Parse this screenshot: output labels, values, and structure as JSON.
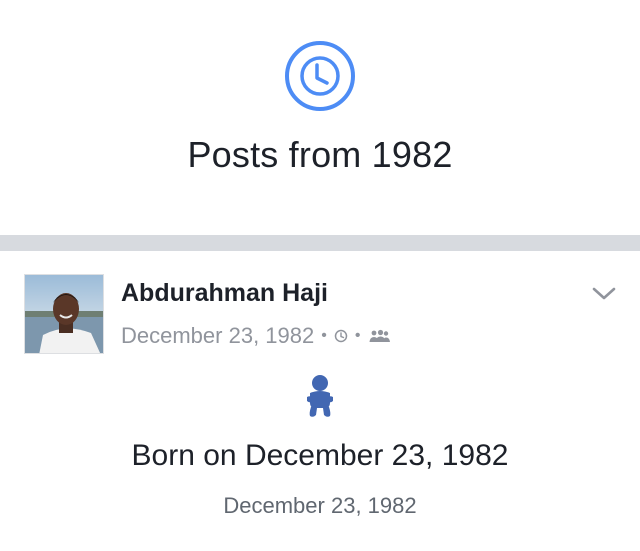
{
  "header": {
    "icon": "clock-icon",
    "title": "Posts from 1982",
    "accent_color": "#4d8cf5"
  },
  "post": {
    "author_name": "Abdurahman Haji",
    "timestamp": "December 23, 1982",
    "meta_icons": [
      "clock-icon",
      "friends-audience-icon"
    ],
    "menu_icon": "chevron-down-icon",
    "event_icon": "baby-icon",
    "event_icon_color": "#4267b2",
    "event_title": "Born on December 23, 1982",
    "event_date": "December 23, 1982"
  }
}
